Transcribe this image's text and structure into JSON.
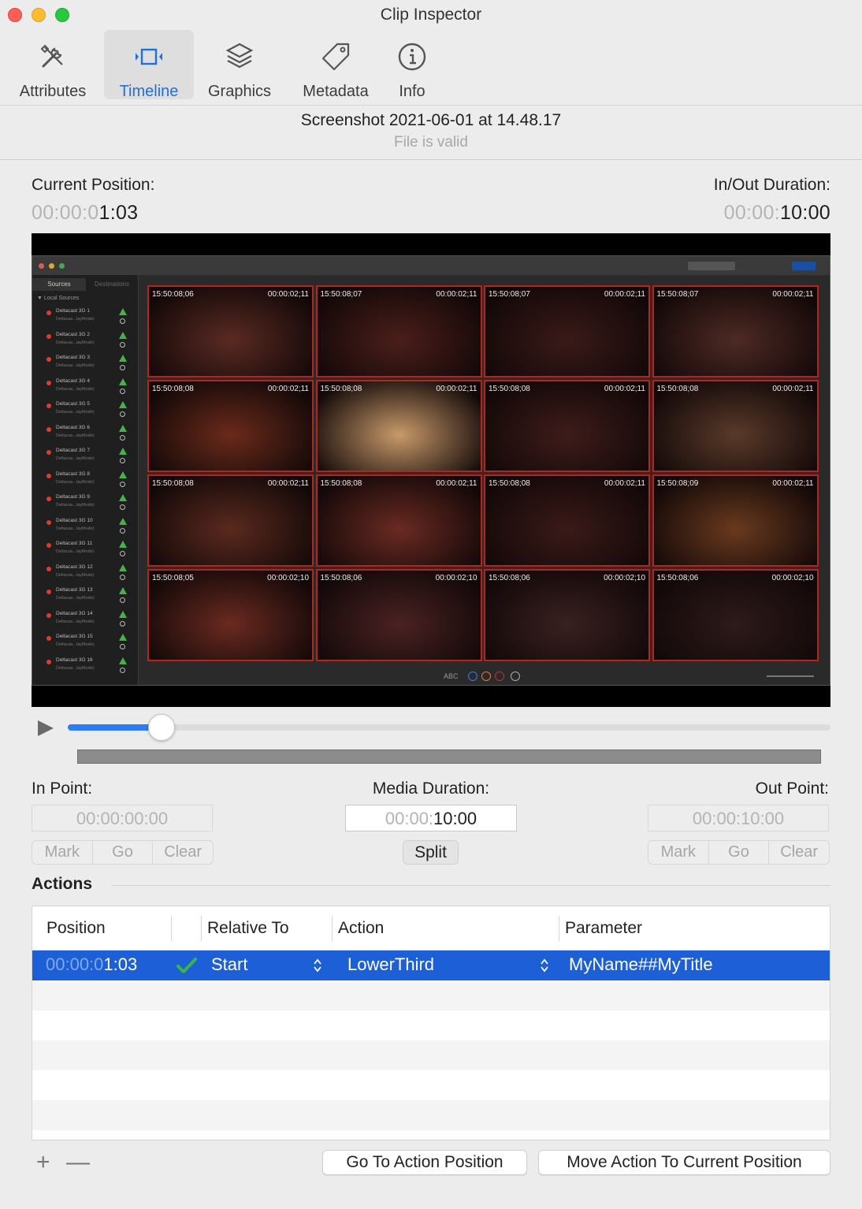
{
  "window": {
    "title": "Clip Inspector"
  },
  "toolbar": {
    "tabs": [
      {
        "label": "Attributes",
        "icon": "tools-icon"
      },
      {
        "label": "Timeline",
        "icon": "film-icon",
        "active": true
      },
      {
        "label": "Graphics",
        "icon": "layers-icon"
      },
      {
        "label": "Metadata",
        "icon": "tag-icon"
      },
      {
        "label": "Info",
        "icon": "info-icon"
      }
    ]
  },
  "file": {
    "name": "Screenshot 2021-06-01 at 14.48.17",
    "status": "File is valid"
  },
  "position": {
    "current_label": "Current Position:",
    "current_dim": "00:00:0",
    "current_bright": "1:03",
    "inout_label": "In/Out Duration:",
    "inout_dim": "00:00:",
    "inout_bright": "10:00"
  },
  "preview": {
    "sidebar_tabs": [
      "Sources",
      "Destinations"
    ],
    "local_sources_label": "▼ Local Sources",
    "sources": [
      {
        "name": "Deltacast 3G 1",
        "sub": "Deltacas...layMode)"
      },
      {
        "name": "Deltacast 3G 2",
        "sub": "Deltacas...layMode)"
      },
      {
        "name": "Deltacast 3G 3",
        "sub": "Deltacas...layMode)"
      },
      {
        "name": "Deltacast 3G 4",
        "sub": "Deltacas...layMode)"
      },
      {
        "name": "Deltacast 3G 5",
        "sub": "Deltacas...layMode)"
      },
      {
        "name": "Deltacast 3G 6",
        "sub": "Deltacas...layMode)"
      },
      {
        "name": "Deltacast 3G 7",
        "sub": "Deltacas...layMode)"
      },
      {
        "name": "Deltacast 3G 8",
        "sub": "Deltacas...layMode)"
      },
      {
        "name": "Deltacast 3G 9",
        "sub": "Deltacas...layMode)"
      },
      {
        "name": "Deltacast 3G 10",
        "sub": "Deltacas...layMode)"
      },
      {
        "name": "Deltacast 3G 11",
        "sub": "Deltacas...layMode)"
      },
      {
        "name": "Deltacast 3G 12",
        "sub": "Deltacas...layMode)"
      },
      {
        "name": "Deltacast 3G 13",
        "sub": "Deltacas...layMode)"
      },
      {
        "name": "Deltacast 3G 14",
        "sub": "Deltacas...layMode)"
      },
      {
        "name": "Deltacast 3G 15",
        "sub": "Deltacas...layMode)"
      },
      {
        "name": "Deltacast 3G 16",
        "sub": "Deltacas...layMode)"
      }
    ],
    "tiles": [
      {
        "tc": "15:50:08;06",
        "dur": "00:00:02;11",
        "color": "#5a2a22"
      },
      {
        "tc": "15:50:08;07",
        "dur": "00:00:02;11",
        "color": "#4a1e1a"
      },
      {
        "tc": "15:50:08;07",
        "dur": "00:00:02;11",
        "color": "#3a1a18"
      },
      {
        "tc": "15:50:08;07",
        "dur": "00:00:02;11",
        "color": "#4e2a24"
      },
      {
        "tc": "15:50:08;08",
        "dur": "00:00:02;11",
        "color": "#6a2a1a"
      },
      {
        "tc": "15:50:08;08",
        "dur": "00:00:02;11",
        "color": "#c89a6a"
      },
      {
        "tc": "15:50:08;08",
        "dur": "00:00:02;11",
        "color": "#3e1c1a"
      },
      {
        "tc": "15:50:08;08",
        "dur": "00:00:02;11",
        "color": "#5a3a2a"
      },
      {
        "tc": "15:50:08;08",
        "dur": "00:00:02;11",
        "color": "#5a2a1e"
      },
      {
        "tc": "15:50:08;08",
        "dur": "00:00:02;11",
        "color": "#6a2a22"
      },
      {
        "tc": "15:50:08;08",
        "dur": "00:00:02;11",
        "color": "#3a1a18"
      },
      {
        "tc": "15:50:08;09",
        "dur": "00:00:02;11",
        "color": "#6a3a1e"
      },
      {
        "tc": "15:50:08;05",
        "dur": "00:00:02;10",
        "color": "#6a2a20"
      },
      {
        "tc": "15:50:08;06",
        "dur": "00:00:02;10",
        "color": "#4a2222"
      },
      {
        "tc": "15:50:08;06",
        "dur": "00:00:02;10",
        "color": "#3a2020"
      },
      {
        "tc": "15:50:08;06",
        "dur": "00:00:02;10",
        "color": "#2e1a1a"
      }
    ],
    "bottom_label": "ABC"
  },
  "scrubber": {
    "progress": 0.122
  },
  "points": {
    "in_label": "In Point:",
    "in_value": "00:00:00:00",
    "media_label": "Media Duration:",
    "media_dim": "00:00:",
    "media_bright": "10:00",
    "out_label": "Out Point:",
    "out_value": "00:00:10:00",
    "mark": "Mark",
    "go": "Go",
    "clear": "Clear",
    "split": "Split"
  },
  "actions": {
    "header": "Actions",
    "columns": [
      "Position",
      "Relative To",
      "Action",
      "Parameter"
    ],
    "rows": [
      {
        "position_dim": "00:00:0",
        "position_bright": "1:03",
        "relative_to": "Start",
        "action": "LowerThird",
        "parameter": "MyName##MyTitle",
        "valid": true
      }
    ]
  },
  "footer": {
    "add": "+",
    "remove": "—",
    "go_to_action": "Go To Action Position",
    "move_action": "Move Action To Current Position"
  },
  "colors": {
    "accent": "#1f6fe0",
    "selection": "#1c5fd6",
    "tile_border": "#b3261e",
    "check": "#3bb44a"
  }
}
